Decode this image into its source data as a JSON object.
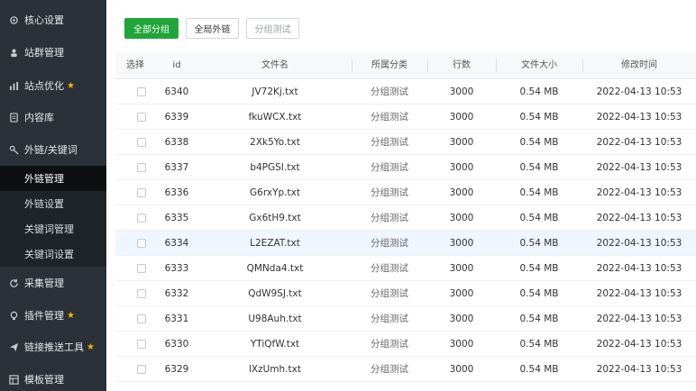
{
  "sidebar": {
    "items": [
      {
        "label": "核心设置",
        "icon": "gear-icon"
      },
      {
        "label": "站群管理",
        "icon": "user-icon"
      },
      {
        "label": "站点优化",
        "icon": "chart-icon",
        "star": true
      },
      {
        "label": "内容库",
        "icon": "document-icon"
      },
      {
        "label": "外链/关键词",
        "icon": "key-icon"
      },
      {
        "label": "采集管理",
        "icon": "refresh-icon"
      },
      {
        "label": "插件管理",
        "icon": "bulb-icon",
        "star": true
      },
      {
        "label": "链接推送工具",
        "icon": "send-icon",
        "star": true
      },
      {
        "label": "模板管理",
        "icon": "template-icon"
      }
    ],
    "subitems": [
      {
        "label": "外链管理",
        "active": true
      },
      {
        "label": "外链设置"
      },
      {
        "label": "关键词管理"
      },
      {
        "label": "关键词设置"
      }
    ],
    "star_glyph": "★"
  },
  "toolbar": {
    "all_groups": "全部分组",
    "global_links": "全局外链",
    "group_test": "分组测试"
  },
  "table": {
    "columns": [
      "选择",
      "id",
      "文件名",
      "所属分类",
      "行数",
      "文件大小",
      "修改时间"
    ],
    "rows": [
      {
        "id": "6340",
        "file": "JV72Kj.txt",
        "category": "分组测试",
        "lines": "3000",
        "size": "0.54 MB",
        "time": "2022-04-13 10:53"
      },
      {
        "id": "6339",
        "file": "fkuWCX.txt",
        "category": "分组测试",
        "lines": "3000",
        "size": "0.54 MB",
        "time": "2022-04-13 10:53"
      },
      {
        "id": "6338",
        "file": "2Xk5Yo.txt",
        "category": "分组测试",
        "lines": "3000",
        "size": "0.54 MB",
        "time": "2022-04-13 10:53"
      },
      {
        "id": "6337",
        "file": "b4PGSI.txt",
        "category": "分组测试",
        "lines": "3000",
        "size": "0.54 MB",
        "time": "2022-04-13 10:53"
      },
      {
        "id": "6336",
        "file": "G6rxYp.txt",
        "category": "分组测试",
        "lines": "3000",
        "size": "0.54 MB",
        "time": "2022-04-13 10:53"
      },
      {
        "id": "6335",
        "file": "Gx6tH9.txt",
        "category": "分组测试",
        "lines": "3000",
        "size": "0.54 MB",
        "time": "2022-04-13 10:53"
      },
      {
        "id": "6334",
        "file": "L2EZAT.txt",
        "category": "分组测试",
        "lines": "3000",
        "size": "0.54 MB",
        "time": "2022-04-13 10:53"
      },
      {
        "id": "6333",
        "file": "QMNda4.txt",
        "category": "分组测试",
        "lines": "3000",
        "size": "0.54 MB",
        "time": "2022-04-13 10:53"
      },
      {
        "id": "6332",
        "file": "QdW9SJ.txt",
        "category": "分组测试",
        "lines": "3000",
        "size": "0.54 MB",
        "time": "2022-04-13 10:53"
      },
      {
        "id": "6331",
        "file": "U98Auh.txt",
        "category": "分组测试",
        "lines": "3000",
        "size": "0.54 MB",
        "time": "2022-04-13 10:53"
      },
      {
        "id": "6330",
        "file": "YTiQfW.txt",
        "category": "分组测试",
        "lines": "3000",
        "size": "0.54 MB",
        "time": "2022-04-13 10:53"
      },
      {
        "id": "6329",
        "file": "lXzUmh.txt",
        "category": "分组测试",
        "lines": "3000",
        "size": "0.54 MB",
        "time": "2022-04-13 10:53"
      }
    ]
  },
  "colors": {
    "accent": "#20a53a",
    "sidebar": "#2b3138",
    "star": "#f0b400"
  }
}
